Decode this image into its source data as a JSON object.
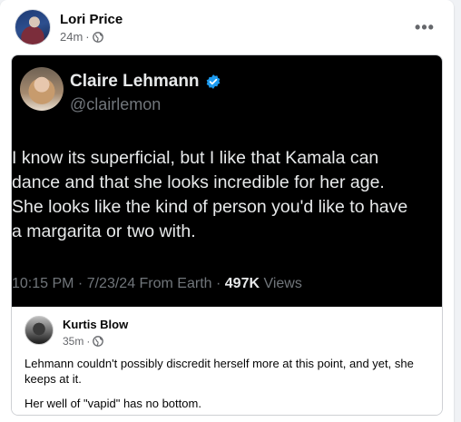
{
  "post": {
    "author": "Lori Price",
    "time": "24m",
    "separator": "·",
    "audience_icon": "globe-icon",
    "more_icon": "more-options-icon"
  },
  "tweet": {
    "name": "Claire Lehmann",
    "handle": "@clairlemon",
    "verified_icon": "verified-badge-icon",
    "lines": [
      "I know its superficial, but I like that Kamala can",
      "dance and that she looks incredible for her age.",
      "She looks like the kind of person you'd like to have",
      "a margarita or two with."
    ],
    "timestamp": "10:15 PM · 7/23/24 From Earth · ",
    "views_count": "497K",
    "views_label": " Views",
    "colors": {
      "background": "#000000",
      "text": "#e7e9ea",
      "muted": "#71767b",
      "verified": "#1d9bf0"
    }
  },
  "comment": {
    "author": "Kurtis Blow",
    "time": "35m",
    "separator": "·",
    "paragraphs": [
      "Lehmann couldn't possibly discredit herself more at this point, and yet, she keeps at it.",
      "Her well of \"vapid\" has no bottom."
    ]
  }
}
